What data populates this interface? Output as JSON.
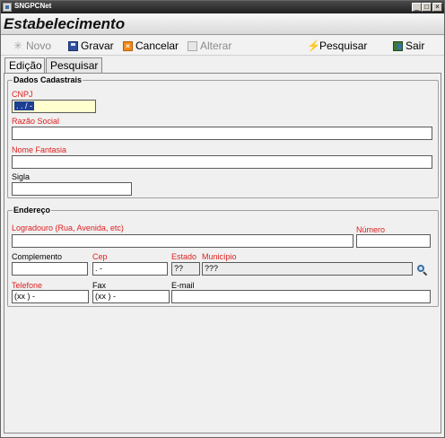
{
  "window": {
    "title": "SNGPCNet",
    "min_label": "_",
    "max_label": "□",
    "close_label": "×"
  },
  "header": {
    "title": "Estabelecimento"
  },
  "toolbar": {
    "novo": "Novo",
    "gravar": "Gravar",
    "cancelar": "Cancelar",
    "alterar": "Alterar",
    "pesquisar": "Pesquisar",
    "sair": "Sair"
  },
  "tabs": {
    "edicao": "Edição",
    "pesquisar": "Pesquisar"
  },
  "dados": {
    "title": "Dados Cadastrais",
    "cnpj_label": "CNPJ",
    "cnpj_value": " .  .  /  - ",
    "razao_label": "Razão Social",
    "razao_value": "",
    "fantasia_label": "Nome Fantasia",
    "fantasia_value": "",
    "sigla_label": "Sigla",
    "sigla_value": ""
  },
  "endereco": {
    "title": "Endereço",
    "logradouro_label": "Logradouro (Rua, Avenida, etc)",
    "logradouro_value": "",
    "numero_label": "Número",
    "numero_value": "",
    "complemento_label": "Complemento",
    "complemento_value": "",
    "cep_label": "Cep",
    "cep_value": "  .   -",
    "estado_label": "Estado",
    "estado_value": "??",
    "municipio_label": "Município",
    "municipio_value": "???",
    "telefone_label": "Telefone",
    "telefone_value": "(xx )    -",
    "fax_label": "Fax",
    "fax_value": "(xx )    -",
    "email_label": "E-mail",
    "email_value": ""
  }
}
